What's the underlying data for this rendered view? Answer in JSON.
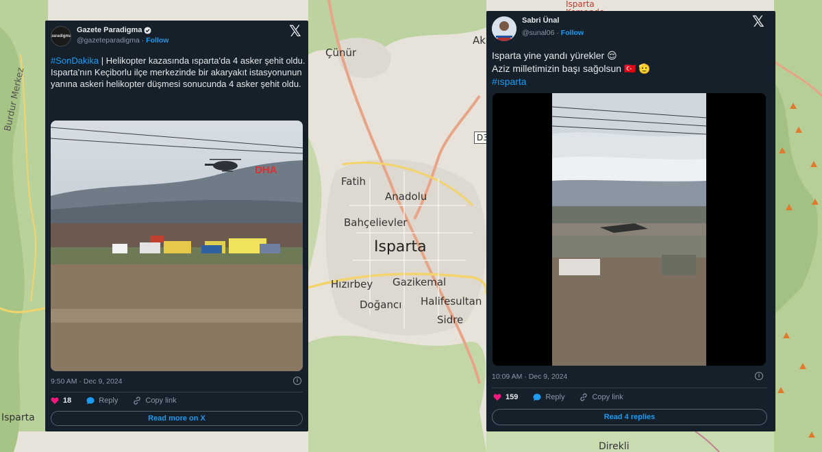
{
  "map": {
    "labels": {
      "cunur": "Çünür",
      "fatih": "Fatih",
      "anadolu": "Anadolu",
      "bahcelievler": "Bahçelievler",
      "isparta_city": "Isparta",
      "hizirbey": "Hızırbey",
      "gazikemal": "Gazikemal",
      "doganci": "Doğancı",
      "halifesultan": "Halifesultan",
      "sidre": "Sidre",
      "direkli": "Direkli",
      "isparta_road": "Isparta",
      "burdur_merkez": "Burdur Merkez",
      "ak": "Ak",
      "komando": "Isparta Komando",
      "road_d3": "D3"
    }
  },
  "tweet1": {
    "display_name": "Gazete Paradigma",
    "handle": "@gazeteparadigma",
    "follow_label": "Follow",
    "avatar_text": "paradigma",
    "hashtag": "#SonDakika",
    "text_line1_rest": " | Helikopter kazasında ısparta'da 4 asker şehit oldu.",
    "text_paragraph2": "Isparta'nın Keçiborlu ilçe merkezinde bir akaryakıt istasyonunun yanına askeri helikopter düşmesi sonucunda 4 asker şehit oldu.",
    "media_watermark": "DHA",
    "timestamp": "9:50 AM · Dec 9, 2024",
    "likes": "18",
    "reply_label": "Reply",
    "copy_link_label": "Copy link",
    "button_label": "Read more on X"
  },
  "tweet2": {
    "display_name": "Sabri Ünal",
    "handle": "@sunal06",
    "follow_label": "Follow",
    "line1": "Isparta yine yandı yürekler 😌",
    "line2": "Aziz milletimizin başı sağolsun 🇹🇷 🫡",
    "hashtag": "#ısparta",
    "timestamp": "10:09 AM · Dec 9, 2024",
    "likes": "159",
    "reply_label": "Reply",
    "copy_link_label": "Copy link",
    "button_label": "Read 4 replies"
  },
  "colors": {
    "card_bg": "#15202b",
    "link_blue": "#1d9bf0",
    "like_pink": "#f91880",
    "muted": "#8b98a5"
  }
}
